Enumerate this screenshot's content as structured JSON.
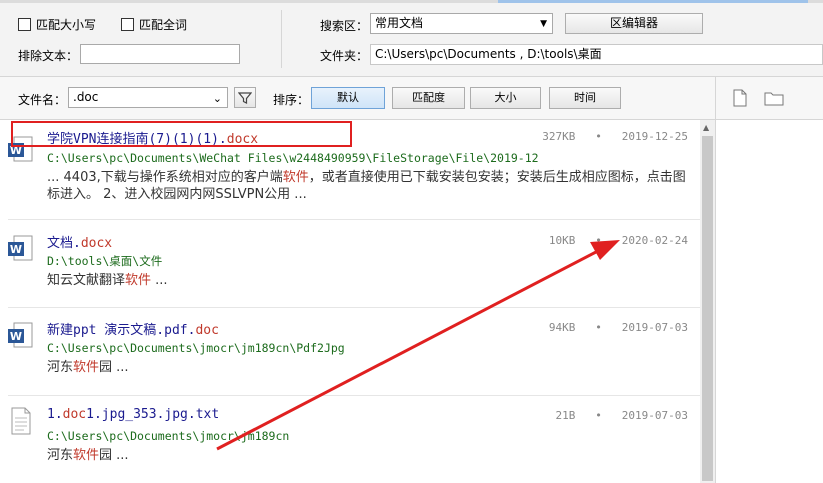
{
  "options": {
    "match_case": "匹配大小写",
    "match_whole": "匹配全词",
    "exclude_label": "排除文本："
  },
  "search_area": {
    "label": "搜索区：",
    "value": "常用文档",
    "editor_button": "区编辑器"
  },
  "folder": {
    "label": "文件夹：",
    "value": "C:\\Users\\pc\\Documents , D:\\tools\\桌面"
  },
  "filename_filter": {
    "label": "文件名：",
    "value": ".doc"
  },
  "sort": {
    "label": "排序：",
    "buttons": [
      "默认",
      "匹配度",
      "大小",
      "时间"
    ]
  },
  "results": [
    {
      "name": "学院VPN连接指南(7)(1)(1).",
      "ext": "docx",
      "size": "327KB",
      "date": "2019-12-25",
      "path": "C:\\Users\\pc\\Documents\\WeChat Files\\w2448490959\\FileStorage\\File\\2019-12",
      "snippet_a": "... 4403,下载与操作系统相对应的客户端",
      "snippet_hl": "软件",
      "snippet_b": "，或者直接使用已下载安装包安装；安装后生成相应图标，点击图标进入。 2、进入校园网内网SSLVPN公用 ..."
    },
    {
      "name": "文档.",
      "ext": "docx",
      "size": "10KB",
      "date": "2020-02-24",
      "path": "D:\\tools\\桌面\\文件",
      "snippet_a": "知云文献翻译",
      "snippet_hl": "软件",
      "snippet_b": " ..."
    },
    {
      "name": "新建ppt 演示文稿.pdf.",
      "ext": "doc",
      "size": "94KB",
      "date": "2019-07-03",
      "path": "C:\\Users\\pc\\Documents\\jmocr\\jm189cn\\Pdf2Jpg",
      "snippet_a": "河东",
      "snippet_hl": "软件",
      "snippet_b": "园 ..."
    },
    {
      "name": "1.",
      "ext": "doc",
      "name_tail": "1.jpg_353.jpg.txt",
      "size": "21B",
      "date": "2019-07-03",
      "path": "C:\\Users\\pc\\Documents\\jmocr\\jm189cn",
      "snippet_a": " 河东",
      "snippet_hl": "软件",
      "snippet_b": "园 ..."
    }
  ],
  "separator": "•",
  "colors": {
    "annotation_red": "#e02020",
    "filename_blue": "#1b1b8f",
    "path_green": "#1c6b1c",
    "highlight_red": "#c0392b"
  }
}
